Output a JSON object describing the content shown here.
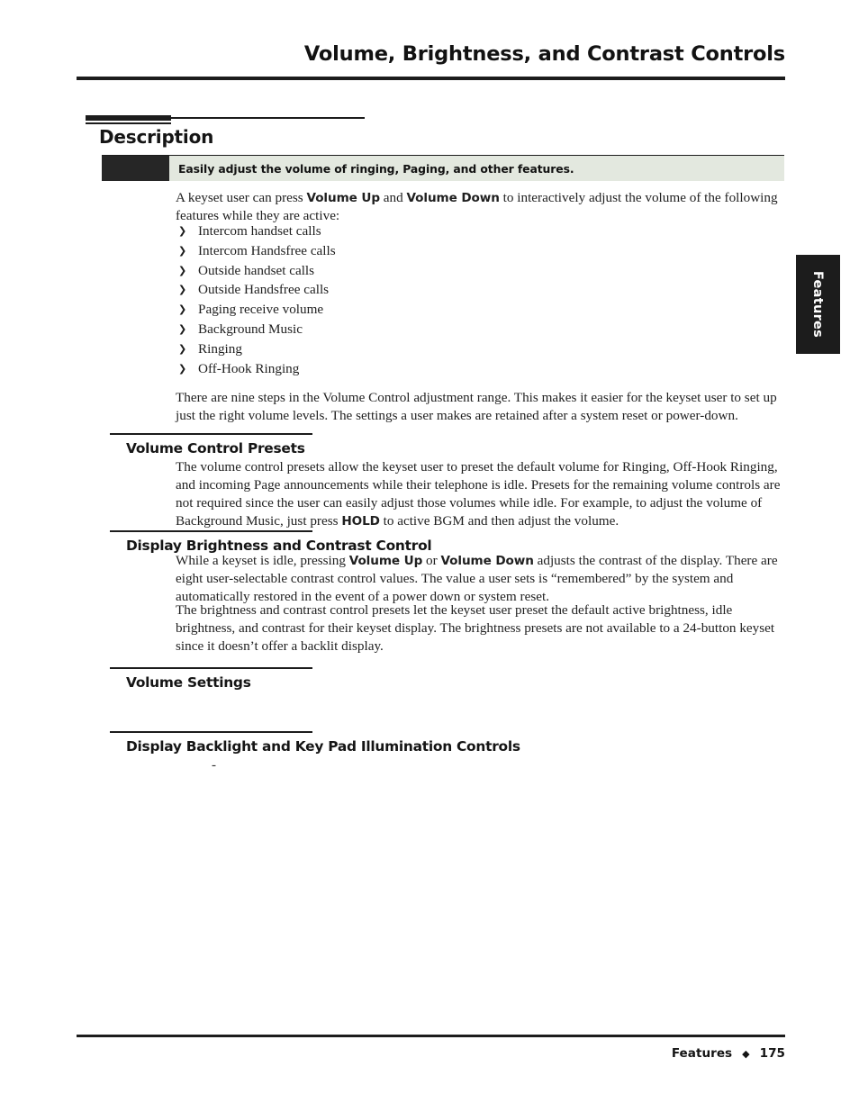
{
  "header": {
    "running_title": "Volume, Brightness, and Contrast Controls"
  },
  "section": {
    "title": "Description",
    "callout": {
      "text": "Easily adjust the volume of ringing, Paging, and other features.",
      "block_color": "#262626",
      "background_color": "#e3e8df"
    },
    "intro_paragraph": {
      "part_1": "A keyset user can press ",
      "bold_1": "Volume Up",
      "part_2": " and ",
      "bold_2": "Volume Down",
      "part_3": " to interactively adjust the volume of the following features while they are active:"
    },
    "bullets": [
      {
        "glyph": "❯",
        "label": "Intercom handset calls"
      },
      {
        "glyph": "❯",
        "label": "Intercom Handsfree calls"
      },
      {
        "glyph": "❯",
        "label": "Outside handset calls"
      },
      {
        "glyph": "❯",
        "label": "Outside Handsfree calls"
      },
      {
        "glyph": "❯",
        "label": "Paging receive volume"
      },
      {
        "glyph": "❯",
        "label": "Background Music"
      },
      {
        "glyph": "❯",
        "label": "Ringing"
      },
      {
        "glyph": "❯",
        "label": "Off-Hook Ringing"
      }
    ],
    "nine_steps_paragraph": "There are nine steps in the Volume Control adjustment range. This makes it easier for the keyset user to set up just the right volume levels. The settings a user makes are retained after a system reset or power-down."
  },
  "subsections": {
    "volume_control_presets": {
      "heading": "Volume Control Presets",
      "paragraph": {
        "part_1": "The volume control presets allow the keyset user to preset the default volume for Ringing, Off-Hook Ringing, and incoming Page announcements while their telephone is idle. Presets for the remaining volume controls are not required since the user can easily adjust those volumes while idle. For example, to adjust the volume of Background Music, just press ",
        "bold_1": "HOLD",
        "part_2": " to active BGM and then adjust the volume."
      }
    },
    "display_brightness_and_contrast": {
      "heading": "Display Brightness and Contrast Control",
      "paragraph_1": {
        "part_1": "While a keyset is idle, pressing ",
        "bold_1": "Volume Up",
        "part_2": " or ",
        "bold_2": "Volume Down",
        "part_3": " adjusts the contrast of the display. There are eight user-selectable contrast control values. The value a user sets is “remembered” by the system and automatically restored in the event of a power down or system reset."
      },
      "paragraph_2": "The brightness and contrast control presets let the keyset user preset the default active brightness, idle brightness, and contrast for their keyset display. The brightness presets are not available to a 24-button keyset since it doesn’t offer a backlit display."
    },
    "volume_settings": {
      "heading": "Volume Settings"
    },
    "display_backlight_and_keypad": {
      "heading": "Display Backlight and Key Pad Illumination Controls",
      "stray_mark": "-"
    }
  },
  "thumb_tab": {
    "label": "Features",
    "color": "#1c1c1c"
  },
  "footer": {
    "section_label": "Features",
    "separator": "◆",
    "page_number": "175"
  }
}
